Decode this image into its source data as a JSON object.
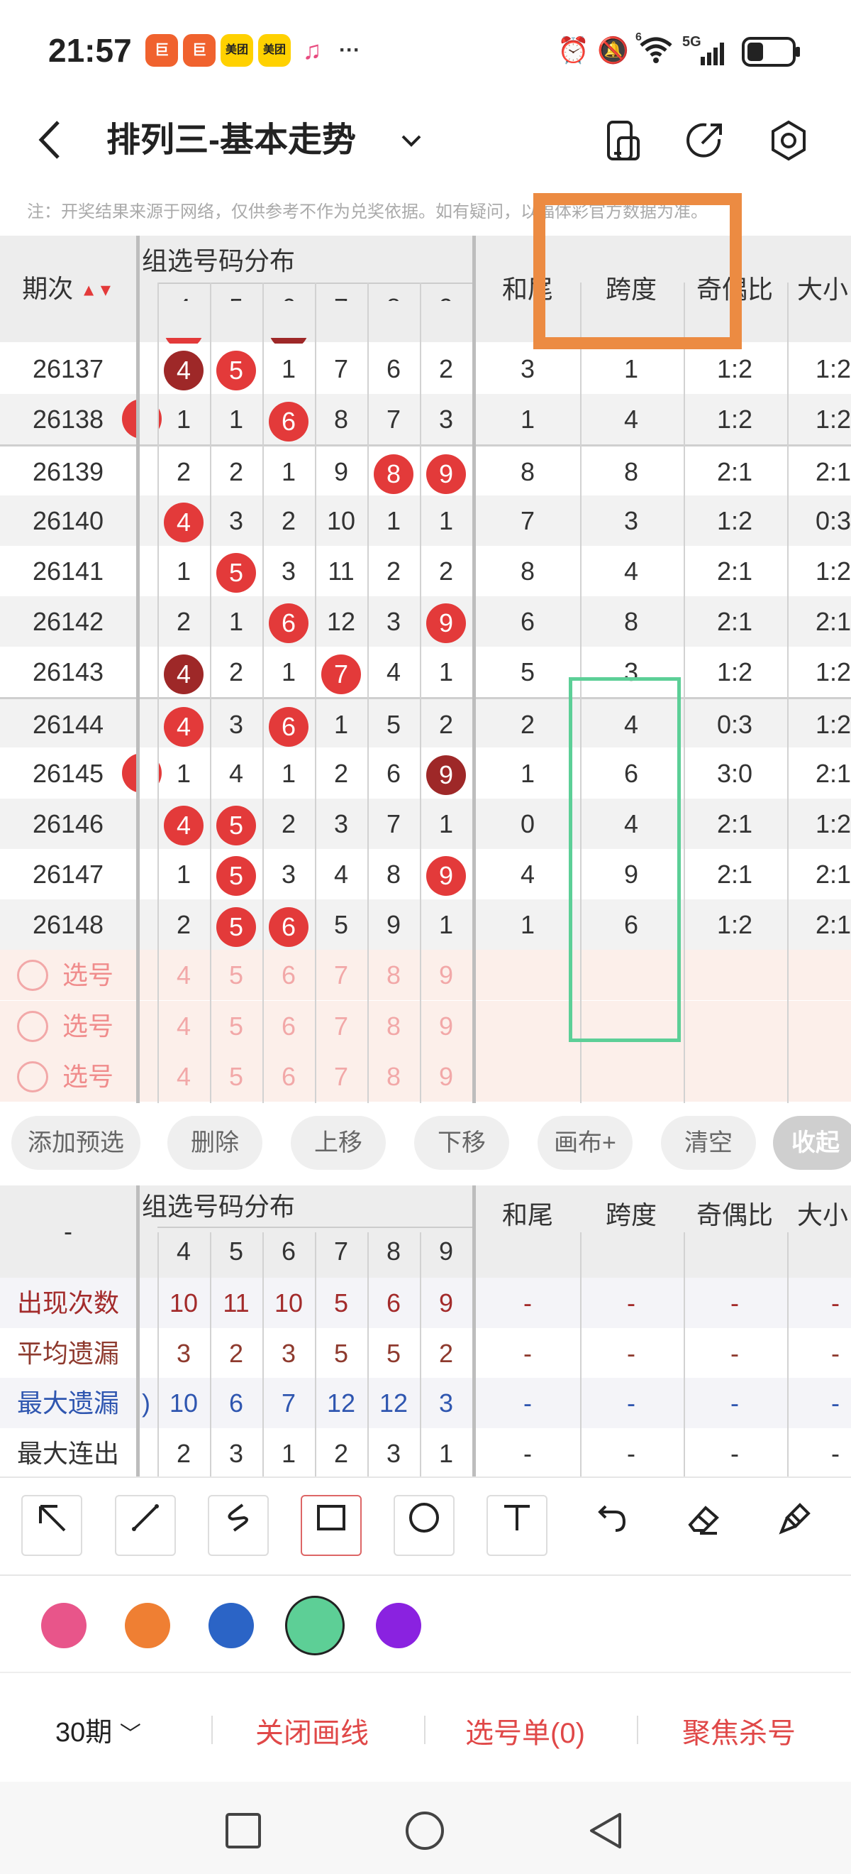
{
  "status": {
    "time": "21:57",
    "apps": [
      "巨",
      "巨",
      "美团",
      "美团",
      "♫",
      "···"
    ],
    "network": "5G",
    "wifi_sup": "6"
  },
  "header": {
    "title": "排列三-基本走势",
    "dropdown": "⌄"
  },
  "notice": "注：开奖结果来源于网络，仅供参考不作为兑奖依据。如有疑问，以福体彩官方数据为准。",
  "table": {
    "period_header": "期次",
    "group_header": "组选号码分布",
    "digit_headers": [
      "4",
      "5",
      "6",
      "7",
      "8",
      "9"
    ],
    "col_headers": [
      "和尾",
      "跨度",
      "奇偶比",
      "大小"
    ],
    "rows": [
      {
        "period": "26137",
        "d": [
          "4",
          "5",
          "1",
          "7",
          "6",
          "2"
        ],
        "s": [
          "d",
          "r",
          "",
          "",
          "",
          ""
        ],
        "left": "",
        "he": "3",
        "kd": "1",
        "jo": "1:2",
        "dx": "1:2"
      },
      {
        "period": "26138",
        "d": [
          "1",
          "1",
          "6",
          "8",
          "7",
          "3"
        ],
        "s": [
          "",
          "",
          "r",
          "",
          "",
          ""
        ],
        "left": "r",
        "he": "1",
        "kd": "4",
        "jo": "1:2",
        "dx": "1:2"
      },
      {
        "period": "26139",
        "d": [
          "2",
          "2",
          "1",
          "9",
          "8",
          "9"
        ],
        "s": [
          "",
          "",
          "",
          "",
          "r",
          "r"
        ],
        "left": "",
        "he": "8",
        "kd": "8",
        "jo": "2:1",
        "dx": "2:1"
      },
      {
        "period": "26140",
        "d": [
          "4",
          "3",
          "2",
          "10",
          "1",
          "1"
        ],
        "s": [
          "r",
          "",
          "",
          "",
          "",
          ""
        ],
        "left": "",
        "he": "7",
        "kd": "3",
        "jo": "1:2",
        "dx": "0:3"
      },
      {
        "period": "26141",
        "d": [
          "1",
          "5",
          "3",
          "11",
          "2",
          "2"
        ],
        "s": [
          "",
          "r",
          "",
          "",
          "",
          ""
        ],
        "left": "",
        "he": "8",
        "kd": "4",
        "jo": "2:1",
        "dx": "1:2"
      },
      {
        "period": "26142",
        "d": [
          "2",
          "1",
          "6",
          "12",
          "3",
          "9"
        ],
        "s": [
          "",
          "",
          "r",
          "",
          "",
          "r"
        ],
        "left": "",
        "he": "6",
        "kd": "8",
        "jo": "2:1",
        "dx": "2:1"
      },
      {
        "period": "26143",
        "d": [
          "4",
          "2",
          "1",
          "7",
          "4",
          "1"
        ],
        "s": [
          "d",
          "",
          "",
          "r",
          "",
          ""
        ],
        "left": "",
        "he": "5",
        "kd": "3",
        "jo": "1:2",
        "dx": "1:2"
      },
      {
        "period": "26144",
        "d": [
          "4",
          "3",
          "6",
          "1",
          "5",
          "2"
        ],
        "s": [
          "r",
          "",
          "r",
          "",
          "",
          ""
        ],
        "left": "",
        "he": "2",
        "kd": "4",
        "jo": "0:3",
        "dx": "1:2"
      },
      {
        "period": "26145",
        "d": [
          "1",
          "4",
          "1",
          "2",
          "6",
          "9"
        ],
        "s": [
          "",
          "",
          "",
          "",
          "",
          "d"
        ],
        "left": "r",
        "he": "1",
        "kd": "6",
        "jo": "3:0",
        "dx": "2:1"
      },
      {
        "period": "26146",
        "d": [
          "4",
          "5",
          "2",
          "3",
          "7",
          "1"
        ],
        "s": [
          "r",
          "r",
          "",
          "",
          "",
          ""
        ],
        "left": "",
        "he": "0",
        "kd": "4",
        "jo": "2:1",
        "dx": "1:2"
      },
      {
        "period": "26147",
        "d": [
          "1",
          "5",
          "3",
          "4",
          "8",
          "9"
        ],
        "s": [
          "",
          "r",
          "",
          "",
          "",
          "r"
        ],
        "left": "",
        "he": "4",
        "kd": "9",
        "jo": "2:1",
        "dx": "2:1"
      },
      {
        "period": "26148",
        "d": [
          "2",
          "5",
          "6",
          "5",
          "9",
          "1"
        ],
        "s": [
          "",
          "r",
          "r",
          "",
          "",
          ""
        ],
        "left": "",
        "he": "1",
        "kd": "6",
        "jo": "1:2",
        "dx": "2:1"
      }
    ],
    "select_rows": [
      {
        "label": "选号",
        "d": [
          "4",
          "5",
          "6",
          "7",
          "8",
          "9"
        ]
      },
      {
        "label": "选号",
        "d": [
          "4",
          "5",
          "6",
          "7",
          "8",
          "9"
        ]
      },
      {
        "label": "选号",
        "d": [
          "4",
          "5",
          "6",
          "7",
          "8",
          "9"
        ]
      }
    ]
  },
  "actions": [
    "添加预选",
    "删除",
    "上移",
    "下移",
    "画布+",
    "清空",
    "收起"
  ],
  "stats": {
    "corner": "-",
    "group_header": "组选号码分布",
    "digit_headers": [
      "4",
      "5",
      "6",
      "7",
      "8",
      "9"
    ],
    "col_headers": [
      "和尾",
      "跨度",
      "奇偶比",
      "大小"
    ],
    "rows": [
      {
        "label": "出现次数",
        "color": "#a32b2b",
        "left": "",
        "v": [
          "10",
          "11",
          "10",
          "5",
          "6",
          "9"
        ],
        "e": [
          "-",
          "-",
          "-",
          "-"
        ]
      },
      {
        "label": "平均遗漏",
        "color": "#8e3a2e",
        "left": "",
        "v": [
          "3",
          "2",
          "3",
          "5",
          "5",
          "2"
        ],
        "e": [
          "-",
          "-",
          "-",
          "-"
        ]
      },
      {
        "label": "最大遗漏",
        "color": "#2f56b0",
        "left": ")",
        "v": [
          "10",
          "6",
          "7",
          "12",
          "12",
          "3"
        ],
        "e": [
          "-",
          "-",
          "-",
          "-"
        ]
      },
      {
        "label": "最大连出",
        "color": "#333333",
        "left": "",
        "v": [
          "2",
          "3",
          "1",
          "2",
          "3",
          "1"
        ],
        "e": [
          "-",
          "-",
          "-",
          "-"
        ]
      }
    ]
  },
  "tools": [
    "arrow-tool",
    "line-tool",
    "curve-tool",
    "rectangle-tool",
    "circle-tool",
    "text-tool",
    "undo-tool",
    "eraser-tool",
    "clear-tool"
  ],
  "palette": [
    "#e8558a",
    "#ef7f33",
    "#2b64c6",
    "#5dcf96",
    "#8a22e0"
  ],
  "bottom": {
    "period": "30期",
    "close_line": "关闭画线",
    "select_list": "选号单(0)",
    "focus_kill": "聚焦杀号"
  }
}
